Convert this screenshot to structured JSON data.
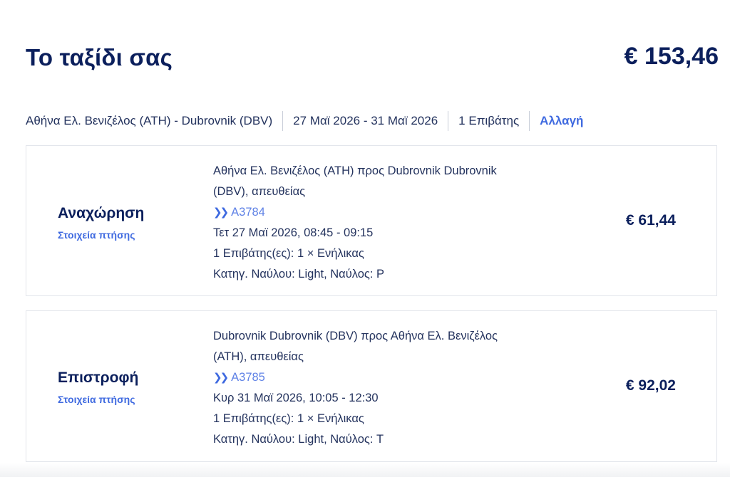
{
  "header": {
    "title": "Το ταξίδι σας",
    "total": "€ 153,46"
  },
  "summary": {
    "route": "Αθήνα Ελ. Βενιζέλος (ATH) - Dubrovnik (DBV)",
    "dates": "27 Μαϊ 2026 - 31 Μαϊ 2026",
    "passengers": "1 Επιβάτης",
    "change_label": "Αλλαγή"
  },
  "outbound": {
    "direction": "Αναχώρηση",
    "details_label": "Στοιχεία πτήσης",
    "route": "Αθήνα Ελ. Βενιζέλος (ATH) προς Dubrovnik Dubrovnik (DBV), απευθείας",
    "flight_number": "A3784",
    "datetime": "Τετ 27 Μαϊ 2026, 08:45 - 09:15",
    "passengers": "1 Επιβάτης(ες): 1 × Ενήλικας",
    "fare": "Κατηγ. Ναύλου: Light, Ναύλος: P",
    "price": "€ 61,44"
  },
  "return": {
    "direction": "Επιστροφή",
    "details_label": "Στοιχεία πτήσης",
    "route": "Dubrovnik Dubrovnik (DBV) προς Αθήνα Ελ. Βενιζέλος (ATH), απευθείας",
    "flight_number": "A3785",
    "datetime": "Κυρ 31 Μαϊ 2026, 10:05 - 12:30",
    "passengers": "1 Επιβάτης(ες): 1 × Ενήλικας",
    "fare": "Κατηγ. Ναύλου: Light, Ναύλος: T",
    "price": "€ 92,02"
  },
  "icons": {
    "flight": "aegean-chevron-icon"
  },
  "colors": {
    "primary_text": "#0b1f5c",
    "link": "#3f6ae0",
    "border": "#e2e5eb"
  }
}
